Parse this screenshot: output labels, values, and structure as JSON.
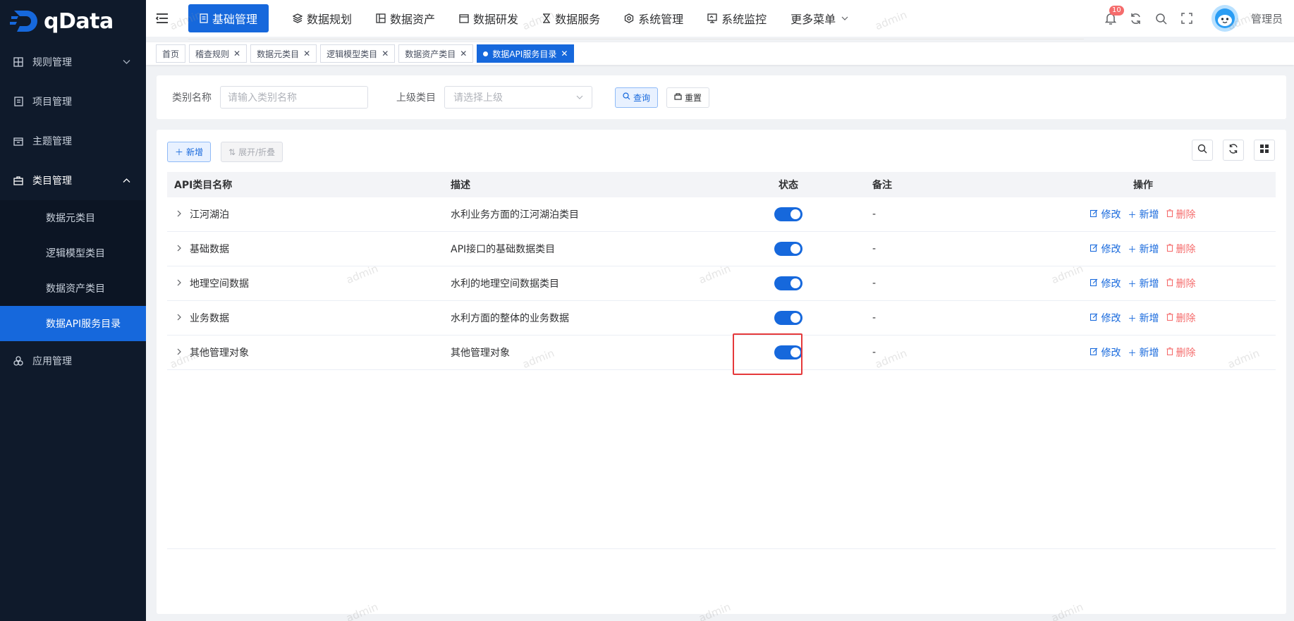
{
  "logo": {
    "text": "qData"
  },
  "sidebar": {
    "items": [
      {
        "label": "规则管理",
        "icon": "grid-icon",
        "chevron": "down"
      },
      {
        "label": "项目管理",
        "icon": "document-icon"
      },
      {
        "label": "主题管理",
        "icon": "calendar-icon"
      },
      {
        "label": "类目管理",
        "icon": "briefcase-icon",
        "chevron": "up",
        "open": true,
        "children": [
          {
            "label": "数据元类目"
          },
          {
            "label": "逻辑模型类目"
          },
          {
            "label": "数据资产类目"
          },
          {
            "label": "数据API服务目录",
            "active": true
          }
        ]
      },
      {
        "label": "应用管理",
        "icon": "apps-icon"
      }
    ]
  },
  "nav": {
    "items": [
      {
        "label": "基础管理",
        "active": true
      },
      {
        "label": "数据规划"
      },
      {
        "label": "数据资产"
      },
      {
        "label": "数据研发"
      },
      {
        "label": "数据服务"
      },
      {
        "label": "系统管理"
      },
      {
        "label": "系统监控"
      },
      {
        "label": "更多菜单"
      }
    ]
  },
  "header": {
    "badge": "10",
    "username": "管理员"
  },
  "tags": [
    {
      "label": "首页",
      "closable": false
    },
    {
      "label": "稽查规则",
      "closable": true
    },
    {
      "label": "数据元类目",
      "closable": true
    },
    {
      "label": "逻辑模型类目",
      "closable": true
    },
    {
      "label": "数据资产类目",
      "closable": true
    },
    {
      "label": "数据API服务目录",
      "closable": true,
      "active": true
    }
  ],
  "search": {
    "name_label": "类别名称",
    "name_placeholder": "请输入类别名称",
    "parent_label": "上级类目",
    "parent_placeholder": "请选择上级",
    "query_label": "查询",
    "reset_label": "重置"
  },
  "toolbar": {
    "add_label": "新增",
    "expand_label": "展开/折叠"
  },
  "table": {
    "columns": [
      "API类目名称",
      "描述",
      "状态",
      "备注",
      "操作"
    ],
    "rows": [
      {
        "name": "江河湖泊",
        "desc": "水利业务方面的江河湖泊类目",
        "status": true,
        "remark": "-"
      },
      {
        "name": "基础数据",
        "desc": "API接口的基础数据类目",
        "status": true,
        "remark": "-"
      },
      {
        "name": "地理空间数据",
        "desc": "水利的地理空间数据类目",
        "status": true,
        "remark": "-"
      },
      {
        "name": "业务数据",
        "desc": "水利方面的整体的业务数据",
        "status": true,
        "remark": "-"
      },
      {
        "name": "其他管理对象",
        "desc": "其他管理对象",
        "status": true,
        "remark": "-"
      }
    ],
    "actions": {
      "edit": "修改",
      "add": "新增",
      "delete": "删除"
    }
  },
  "watermark": "admin",
  "colors": {
    "primary": "#1668dc",
    "sidebar_bg": "#0f1a2b",
    "danger": "#f56c6c",
    "highlight": "#e5393b"
  }
}
